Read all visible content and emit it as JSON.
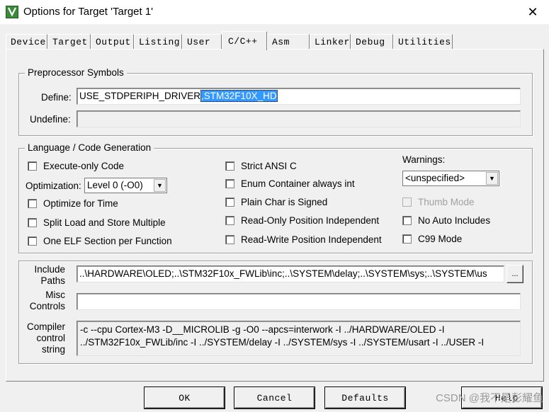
{
  "window": {
    "title": "Options for Target 'Target 1'",
    "close_glyph": "✕",
    "icon": "keil-target-icon"
  },
  "tabs": [
    {
      "label": "Device",
      "active": false
    },
    {
      "label": "Target",
      "active": false
    },
    {
      "label": "Output",
      "active": false
    },
    {
      "label": "Listing",
      "active": false
    },
    {
      "label": "User",
      "active": false
    },
    {
      "label": "C/C++",
      "active": true
    },
    {
      "label": "Asm",
      "active": false
    },
    {
      "label": "Linker",
      "active": false
    },
    {
      "label": "Debug",
      "active": false
    },
    {
      "label": "Utilities",
      "active": false
    }
  ],
  "preprocessor": {
    "title": "Preprocessor Symbols",
    "define_label": "Define:",
    "define_value_plain": "USE_STDPERIPH_DRIVER",
    "define_value_selected": ",STM32F10X_HD",
    "undefine_label": "Undefine:",
    "undefine_value": ""
  },
  "codegen": {
    "title": "Language / Code Generation",
    "execute_only": "Execute-only Code",
    "optimization_label": "Optimization:",
    "optimization_value": "Level 0 (-O0)",
    "optimize_time": "Optimize for Time",
    "split_load": "Split Load and Store Multiple",
    "one_elf": "One ELF Section per Function",
    "strict_ansi": "Strict ANSI C",
    "enum_container": "Enum Container always int",
    "plain_char": "Plain Char is Signed",
    "ro_pi": "Read-Only Position Independent",
    "rw_pi": "Read-Write Position Independent",
    "warnings_label": "Warnings:",
    "warnings_value": "<unspecified>",
    "thumb_mode": "Thumb Mode",
    "no_auto_includes": "No Auto Includes",
    "c99_mode": "C99 Mode"
  },
  "paths": {
    "include_label_1": "Include",
    "include_label_2": "Paths",
    "include_value": "..\\HARDWARE\\OLED;..\\STM32F10x_FWLib\\inc;..\\SYSTEM\\delay;..\\SYSTEM\\sys;..\\SYSTEM\\us",
    "browse_label": "...",
    "misc_label_1": "Misc",
    "misc_label_2": "Controls",
    "misc_value": "",
    "compiler_label_1": "Compiler",
    "compiler_label_2": "control",
    "compiler_label_3": "string",
    "compiler_line_1": "-c --cpu Cortex-M3 -D__MICROLIB -g -O0 --apcs=interwork -I ../HARDWARE/OLED -I",
    "compiler_line_2": "../STM32F10x_FWLib/inc -I ../SYSTEM/delay -I ../SYSTEM/sys -I ../SYSTEM/usart -I ../USER -I"
  },
  "buttons": {
    "ok": "OK",
    "cancel": "Cancel",
    "defaults": "Defaults",
    "help": "Help"
  },
  "watermark": "CSDN @我不是彭耀鱼"
}
